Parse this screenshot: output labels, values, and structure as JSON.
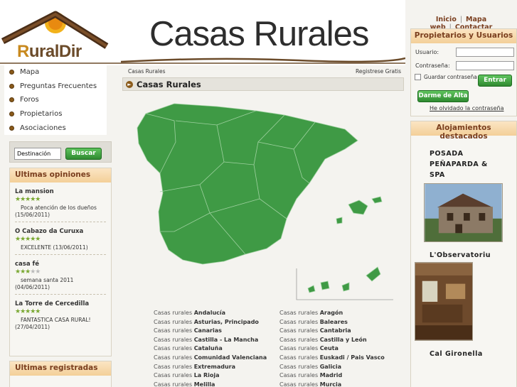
{
  "header": {
    "logo_text_r": "R",
    "logo_text_rest": "uralDir",
    "banner_title": "Casas Rurales"
  },
  "top_links": [
    "Inicio",
    "Mapa web",
    "Contactar"
  ],
  "left_nav": [
    "Mapa",
    "Preguntas Frecuentes",
    "Foros",
    "Propietarios",
    "Asociaciones"
  ],
  "search": {
    "value": "Destinación",
    "button": "Buscar"
  },
  "opinions": {
    "title": "Ultimas opiniones",
    "items": [
      {
        "name": "La mansion",
        "stars": 5,
        "line1": "Poca atención de los dueños",
        "line2": "(15/06/2011)"
      },
      {
        "name": "O Cabazo da Curuxa",
        "stars": 5,
        "line1": "EXCELENTE (13/06/2011)",
        "line2": ""
      },
      {
        "name": "casa fé",
        "stars": 3,
        "line1": "semana santa 2011",
        "line2": "(04/06/2011)"
      },
      {
        "name": "La Torre de Cercedilla",
        "stars": 5,
        "line1": "FANTASTICA CASA RURAL!",
        "line2": "(27/04/2011)"
      }
    ]
  },
  "registered": {
    "title": "Ultimas registradas"
  },
  "main": {
    "breadcrumb": "Casas Rurales",
    "register_free": "Registrese Gratis",
    "heading": "Casas Rurales",
    "prefix": "Casas rurales",
    "regions_left": [
      "Andalucía",
      "Asturias, Principado",
      "Canarias",
      "Castilla - La Mancha",
      "Cataluña",
      "Comunidad Valenciana",
      "Extremadura",
      "La Rioja",
      "Melilla"
    ],
    "regions_right": [
      "Aragón",
      "Baleares",
      "Cantabria",
      "Castilla y León",
      "Ceuta",
      "Euskadi / Pais Vasco",
      "Galicia",
      "Madrid",
      "Murcia"
    ]
  },
  "login": {
    "title": "Propietarios y Usuarios",
    "user_label": "Usuario:",
    "pass_label": "Contraseña:",
    "remember": "Guardar contraseña",
    "enter": "Entrar",
    "signup": "Darme de Alta",
    "forgot": "He olvidado la contraseña"
  },
  "featured": {
    "title": "Alojamientos destacados",
    "items": [
      "POSADA PEÑAPARDA & SPA",
      "L'Observatoriu",
      "Cal Gironella"
    ]
  },
  "colors": {
    "map_green": "#3f9a45",
    "header_brown": "#7a3e1e",
    "accent_green": "#2f8a30"
  }
}
